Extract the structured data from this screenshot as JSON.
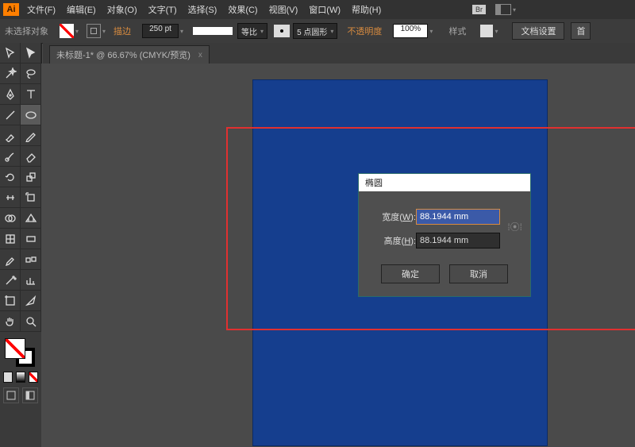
{
  "menubar": {
    "logo": "Ai",
    "items": [
      "文件(F)",
      "编辑(E)",
      "对象(O)",
      "文字(T)",
      "选择(S)",
      "效果(C)",
      "视图(V)",
      "窗口(W)",
      "帮助(H)"
    ],
    "br_badge": "Br"
  },
  "options": {
    "no_selection": "未选择对象",
    "stroke_label": "描边",
    "stroke_value": "250 pt",
    "uniform_label": "等比",
    "brush_label": "5 点圆形",
    "uniform_arrow": "▾",
    "opacity_label": "不透明度",
    "opacity_value": "100%",
    "style_label": "样式",
    "doc_setup": "文档设置",
    "prefs": "首"
  },
  "tab": {
    "label": "未标题-1* @ 66.67% (CMYK/预览)",
    "close": "x"
  },
  "dialog": {
    "title": "椭圆",
    "width_label": "宽度(W):",
    "height_label": "高度(H):",
    "width_value": "88.1944 mm",
    "height_value": "88.1944 mm",
    "ok": "确定",
    "cancel": "取消"
  },
  "tools": {
    "items": [
      "selection",
      "direct-selection",
      "magic-wand",
      "lasso",
      "pen",
      "type",
      "line",
      "ellipse",
      "paintbrush",
      "pencil",
      "blob-brush",
      "eraser",
      "rotate",
      "scale",
      "width",
      "free-transform",
      "shape-builder",
      "perspective",
      "mesh",
      "gradient",
      "eyedropper",
      "blend",
      "symbol-sprayer",
      "column-graph",
      "artboard",
      "slice",
      "hand",
      "zoom"
    ]
  }
}
